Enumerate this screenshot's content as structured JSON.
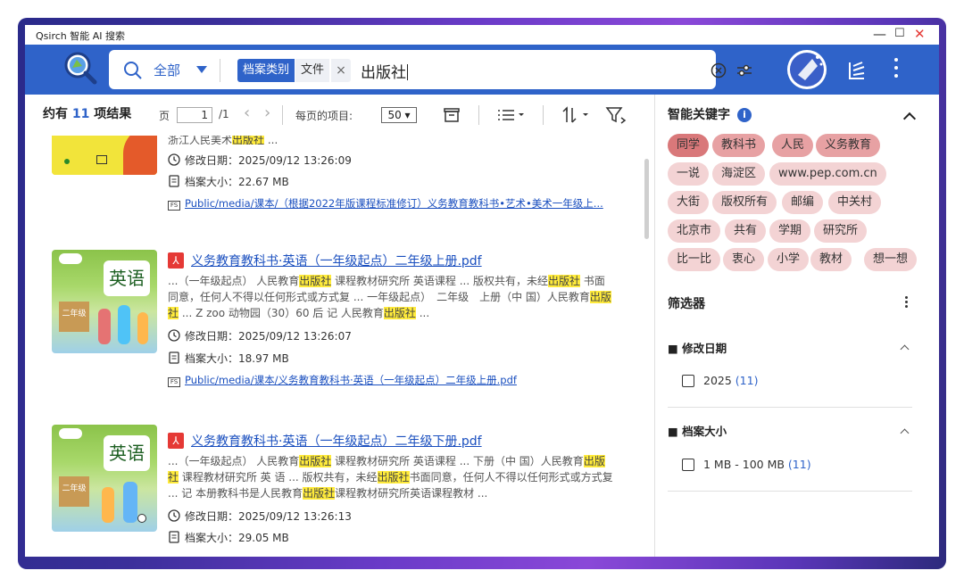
{
  "window": {
    "title": "Qsirch 智能 AI 搜索",
    "minimize": "—",
    "maximize": "☐",
    "close": "✕"
  },
  "search": {
    "scope": "全部",
    "chip_label": "档案类别",
    "chip_value": "文件",
    "chip_remove": "×",
    "query": "出版社"
  },
  "toolbar": {
    "count_prefix": "约有",
    "count": "11",
    "count_suffix": "项结果",
    "page_label": "页",
    "page_value": "1",
    "page_total": "/1",
    "prev": "‹",
    "next": "›",
    "per_page_label": "每页的项目:",
    "per_page_value": "50 ▾"
  },
  "results": [
    {
      "snippet_tail_pre": "浙江人民美术",
      "snippet_tail_hl": "出版社",
      "snippet_tail_post": " ...",
      "modified": "修改日期：2025/09/12 13:26:09",
      "size": "档案大小：22.67 MB",
      "path": "Public/media/课本/（根据2022年版课程标准修订）义务教育教科书•艺术•美术一年级上..."
    },
    {
      "title": "义务教育教科书·英语（一年级起点）二年级上册.pdf",
      "snippet": [
        {
          "t": "...（一年级起点） 人民教育"
        },
        {
          "t": "出版社",
          "hl": true
        },
        {
          "t": " 课程教材研究所 英语课程 ... 版权共有，未经"
        },
        {
          "t": "出版社",
          "hl": true
        },
        {
          "t": " 书面同意，任何人不得以任何形式或方式复 ... 一年级起点）　二年级　上册（中 国）人民教育"
        },
        {
          "t": "出版社",
          "hl": true
        },
        {
          "t": " ... Z zoo 动物园（30）60 后 记 人民教育"
        },
        {
          "t": "出版社",
          "hl": true
        },
        {
          "t": " ..."
        }
      ],
      "modified": "修改日期：2025/09/12 13:26:07",
      "size": "档案大小：18.97 MB",
      "path": "Public/media/课本/义务教育教科书·英语（一年级起点）二年级上册.pdf",
      "thumb_text": "英语",
      "thumb_grade": "二年级"
    },
    {
      "title": "义务教育教科书·英语（一年级起点）二年级下册.pdf",
      "snippet": [
        {
          "t": "...（一年级起点） 人民教育"
        },
        {
          "t": "出版社",
          "hl": true
        },
        {
          "t": " 课程教材研究所 英语课程 ... 下册（中 国）人民教育"
        },
        {
          "t": "出版社",
          "hl": true
        },
        {
          "t": " 课程教材研究所 英 语 ... 版权共有，未经"
        },
        {
          "t": "出版社",
          "hl": true
        },
        {
          "t": "书面同意，任何人不得以任何形式或方式复 ... 记 本册教科书是人民教育"
        },
        {
          "t": "出版社",
          "hl": true
        },
        {
          "t": "课程教材研究所英语课程教材 ..."
        }
      ],
      "modified": "修改日期：2025/09/12 13:26:13",
      "size": "档案大小：29.05 MB",
      "thumb_text": "英语",
      "thumb_grade": "二年级"
    }
  ],
  "keywords": {
    "title": "智能关键字",
    "info": "i",
    "tags": [
      "同学",
      "教科书",
      "人民",
      "义务教育",
      "一说",
      "海淀区",
      "www.pep.com.cn",
      "大街",
      "版权所有",
      "邮编",
      "中关村",
      "北京市",
      "共有",
      "学期",
      "研究所",
      "比一比",
      "衷心",
      "小学",
      "教材",
      "想一想"
    ]
  },
  "filters": {
    "title": "筛选器",
    "modified": {
      "title": "修改日期",
      "option": "2025",
      "count": "(11)"
    },
    "size": {
      "title": "档案大小",
      "option": "1 MB - 100 MB",
      "count": "(11)"
    }
  },
  "colors": {
    "brand": "#2f63c9",
    "tag_dark": "#d9787a",
    "tag_mid": "#e7a1a3",
    "tag_light": "#f3d3d4",
    "highlight": "#ffeb3b",
    "pdf": "#e53935"
  }
}
